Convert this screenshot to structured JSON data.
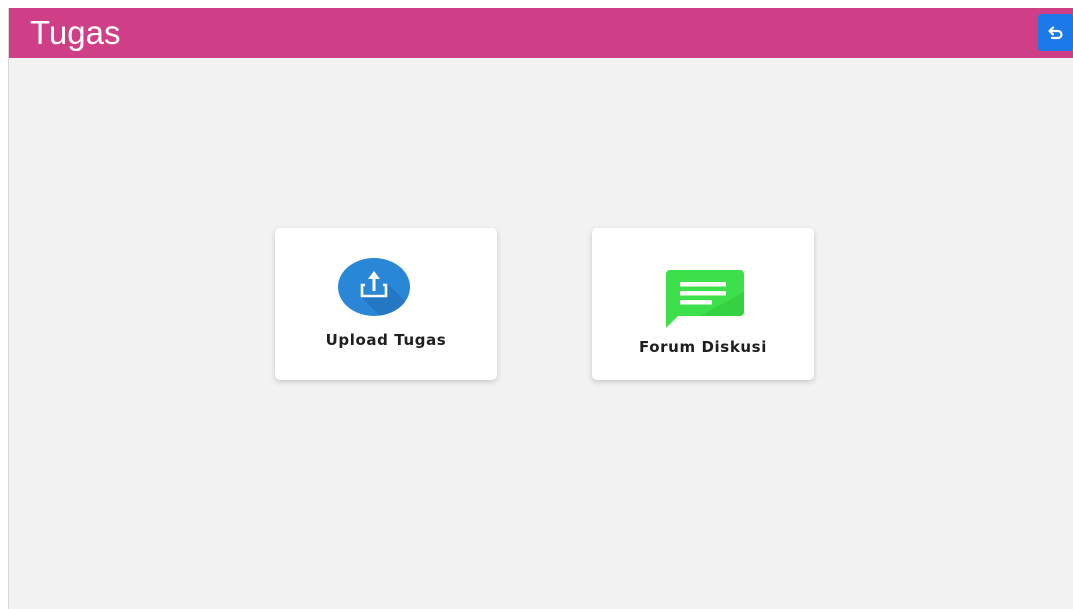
{
  "header": {
    "title": "Tugas",
    "color": "#cf3f88",
    "back_button_color": "#1b79e8",
    "back_icon": "undo-arrow-icon"
  },
  "menu": [
    {
      "label": "Upload Tugas",
      "icon": "upload-icon",
      "icon_color": "#2a86d6"
    },
    {
      "label": "Forum Diskusi",
      "icon": "chat-bubble-icon",
      "icon_color": "#3de04a"
    }
  ]
}
